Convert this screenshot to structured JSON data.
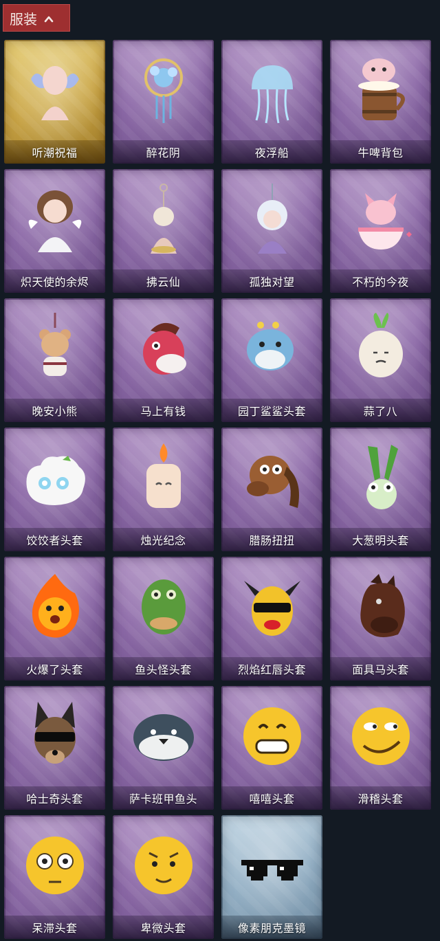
{
  "header": {
    "label": "服装",
    "toggle_icon": "chevron-up-icon"
  },
  "items": [
    {
      "name": "听潮祝福",
      "icon": "angel-wings-icon",
      "style": "gold"
    },
    {
      "name": "醉花阴",
      "icon": "flower-ornament-icon",
      "style": "purple"
    },
    {
      "name": "夜浮船",
      "icon": "jellyfish-icon",
      "style": "purple"
    },
    {
      "name": "牛啤背包",
      "icon": "beer-barrel-cow-icon",
      "style": "purple"
    },
    {
      "name": "炽天使的余烬",
      "icon": "angel-doll-icon",
      "style": "purple"
    },
    {
      "name": "拂云仙",
      "icon": "hanging-charm-icon",
      "style": "purple"
    },
    {
      "name": "孤独对望",
      "icon": "hanging-doll-icon",
      "style": "purple"
    },
    {
      "name": "不朽的今夜",
      "icon": "fox-bowl-icon",
      "style": "purple"
    },
    {
      "name": "晚安小熊",
      "icon": "teddy-bear-icon",
      "style": "purple"
    },
    {
      "name": "马上有钱",
      "icon": "red-horse-head-icon",
      "style": "purple"
    },
    {
      "name": "园丁鲨鲨头套",
      "icon": "shark-head-icon",
      "style": "purple"
    },
    {
      "name": "蒜了八",
      "icon": "garlic-head-icon",
      "style": "purple"
    },
    {
      "name": "饺饺者头套",
      "icon": "dumpling-head-icon",
      "style": "purple"
    },
    {
      "name": "烛光纪念",
      "icon": "candle-head-icon",
      "style": "purple"
    },
    {
      "name": "腊肠扭扭",
      "icon": "dachshund-head-icon",
      "style": "purple"
    },
    {
      "name": "大葱明头套",
      "icon": "scallion-head-icon",
      "style": "purple"
    },
    {
      "name": "火爆了头套",
      "icon": "fire-head-icon",
      "style": "purple"
    },
    {
      "name": "鱼头怪头套",
      "icon": "fish-head-icon",
      "style": "purple"
    },
    {
      "name": "烈焰红唇头套",
      "icon": "yellow-mask-icon",
      "style": "purple"
    },
    {
      "name": "面具马头套",
      "icon": "horse-mask-icon",
      "style": "purple"
    },
    {
      "name": "哈士奇头套",
      "icon": "husky-head-icon",
      "style": "purple"
    },
    {
      "name": "萨卡班甲鱼头",
      "icon": "whale-head-icon",
      "style": "purple"
    },
    {
      "name": "嘻嘻头套",
      "icon": "grin-emoji-icon",
      "style": "purple"
    },
    {
      "name": "滑稽头套",
      "icon": "funny-emoji-icon",
      "style": "purple"
    },
    {
      "name": "呆滞头套",
      "icon": "stare-emoji-icon",
      "style": "purple"
    },
    {
      "name": "卑微头套",
      "icon": "humble-emoji-icon",
      "style": "purple"
    },
    {
      "name": "像素朋克墨镜",
      "icon": "pixel-sunglasses-icon",
      "style": "blue"
    }
  ]
}
